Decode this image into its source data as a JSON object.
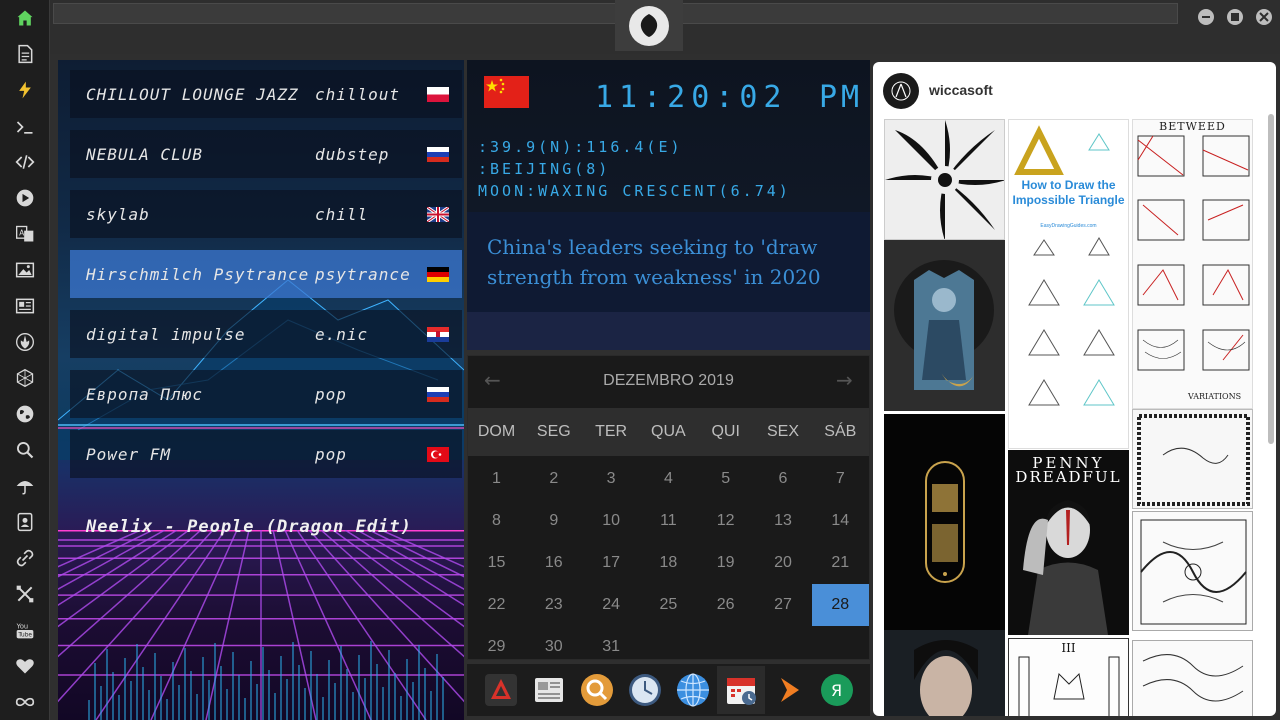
{
  "sidebar": {
    "items": [
      {
        "icon": "home-icon",
        "color": "#5fd35f"
      },
      {
        "icon": "document-icon"
      },
      {
        "icon": "lightning-icon",
        "color": "#f2c230"
      },
      {
        "icon": "terminal-icon"
      },
      {
        "icon": "code-icon"
      },
      {
        "icon": "play-icon"
      },
      {
        "icon": "translate-icon"
      },
      {
        "icon": "image-icon"
      },
      {
        "icon": "newspaper-icon"
      },
      {
        "icon": "rebel-icon"
      },
      {
        "icon": "hexagon-icon"
      },
      {
        "icon": "globe-icon"
      },
      {
        "icon": "search-icon"
      },
      {
        "icon": "umbrella-icon"
      },
      {
        "icon": "contacts-icon"
      },
      {
        "icon": "link-icon"
      },
      {
        "icon": "tools-icon"
      },
      {
        "icon": "youtube-icon",
        "label": "You Tube"
      },
      {
        "icon": "heart-icon"
      },
      {
        "icon": "infinity-icon"
      }
    ]
  },
  "radio": {
    "stations": [
      {
        "name": "CHILLOUT LOUNGE JAZZ",
        "genre": "chillout",
        "flag": "poland"
      },
      {
        "name": "NEBULA CLUB",
        "genre": "dubstep",
        "flag": "russia"
      },
      {
        "name": "skylab",
        "genre": "chill",
        "flag": "uk"
      },
      {
        "name": "Hirschmilch Psytrance",
        "genre": "psytrance",
        "flag": "germany",
        "active": true
      },
      {
        "name": "digital impulse",
        "genre": "e.nic",
        "flag": "croatia"
      },
      {
        "name": "Европа Плюс",
        "genre": "pop",
        "flag": "russia"
      },
      {
        "name": "Power FM",
        "genre": "pop",
        "flag": "turkey"
      }
    ],
    "now_playing": "Neelix - People (Dragon Edit)"
  },
  "clock": {
    "time": "11:20:02",
    "ampm": "PM",
    "coords": ":39.9(N):116.4(E)",
    "city": ":BEIJING(8)",
    "moon": "MOON:WAXING CRESCENT(6.74)"
  },
  "news": {
    "headline": "China's leaders seeking to 'draw strength from weakness' in 2020"
  },
  "calendar": {
    "month": "DEZEMBRO 2019",
    "prev": "←",
    "next": "→",
    "weekdays": [
      "DOM",
      "SEG",
      "TER",
      "QUA",
      "QUI",
      "SEX",
      "SÁB"
    ],
    "days": [
      [
        "1",
        "2",
        "3",
        "4",
        "5",
        "6",
        "7"
      ],
      [
        "8",
        "9",
        "10",
        "11",
        "12",
        "13",
        "14"
      ],
      [
        "15",
        "16",
        "17",
        "18",
        "19",
        "20",
        "21"
      ],
      [
        "22",
        "23",
        "24",
        "25",
        "26",
        "27",
        "28"
      ],
      [
        "29",
        "30",
        "31"
      ]
    ],
    "today": "28",
    "accent": "#4a8fd8"
  },
  "dock": {
    "items": [
      "app-launcher-icon",
      "news-reader-icon",
      "search-icon",
      "clock-icon",
      "globe-icon",
      "calendar-icon",
      "play-icon",
      "yandex-icon"
    ],
    "yandex_label": "Я"
  },
  "pinterest": {
    "username": "wiccasoft",
    "impossible_triangle_title": "How to Draw the Impossible Triangle",
    "site": "EasyDrawingGuides.com",
    "betweed_label": "BETWEED",
    "variations_label": "VARIATIONS",
    "penny_title_1": "PENNY",
    "penny_title_2": "DREADFUL",
    "tarot_numeral": "III"
  },
  "colors": {
    "accent_blue": "#38a9e6",
    "news_blue": "#3b8fd6"
  }
}
